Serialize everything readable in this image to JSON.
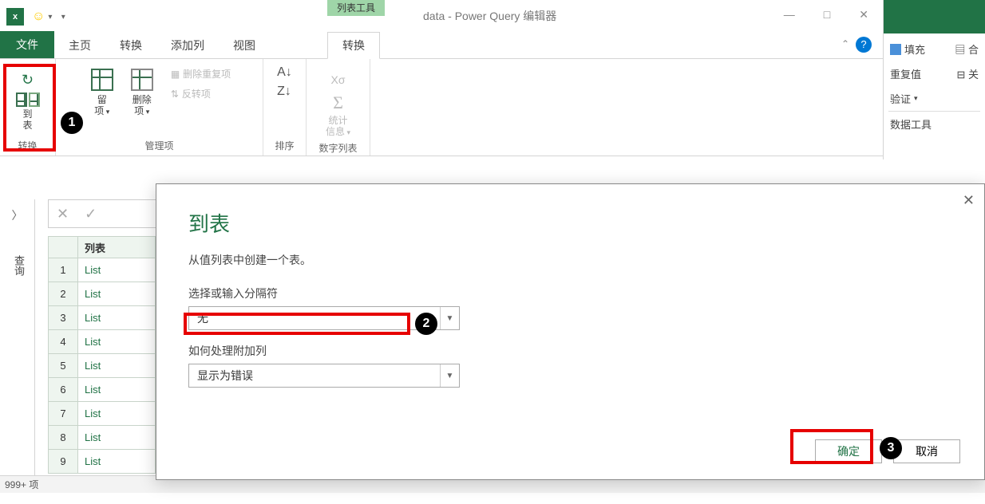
{
  "titlebar": {
    "app_icon_text": "x",
    "contextual_tab": "列表工具",
    "window_title": "data - Power Query 编辑器"
  },
  "window_controls": {
    "minimize": "—",
    "maximize": "□",
    "close": "✕"
  },
  "tabs": {
    "file": "文件",
    "home": "主页",
    "transform": "转换",
    "add_column": "添加列",
    "view": "视图",
    "transform2": "转换"
  },
  "ribbon": {
    "to_table": {
      "label_line1": "到",
      "label_line2": "表"
    },
    "keep_items": {
      "label_line1": "留",
      "label_line2": "项"
    },
    "remove_items": {
      "label_line1": "删除",
      "label_line2": "项"
    },
    "remove_duplicates": "删除重复项",
    "reverse": "反转项",
    "statistics": {
      "label_line1": "统计",
      "label_line2": "信息"
    },
    "group_transform": "转换",
    "group_manage": "管理项",
    "group_sort": "排序",
    "group_numeric": "数字列表"
  },
  "ribbon_collapse": "⌃",
  "side": {
    "arrow": "〉",
    "label": "查询"
  },
  "formula_bar": {
    "cancel": "✕",
    "confirm": "✓"
  },
  "grid": {
    "col_header": "列表",
    "rows": [
      {
        "n": "1",
        "v": "List"
      },
      {
        "n": "2",
        "v": "List"
      },
      {
        "n": "3",
        "v": "List"
      },
      {
        "n": "4",
        "v": "List"
      },
      {
        "n": "5",
        "v": "List"
      },
      {
        "n": "6",
        "v": "List"
      },
      {
        "n": "7",
        "v": "List"
      },
      {
        "n": "8",
        "v": "List"
      },
      {
        "n": "9",
        "v": "List"
      }
    ]
  },
  "dialog": {
    "title": "到表",
    "description": "从值列表中创建一个表。",
    "delimiter_label": "选择或输入分隔符",
    "delimiter_value": "无",
    "extra_cols_label": "如何处理附加列",
    "extra_cols_value": "显示为错误",
    "ok": "确定",
    "cancel": "取消",
    "close": "✕"
  },
  "statusbar": {
    "count": "999+ 项"
  },
  "excel_peek": {
    "fill": "填充",
    "merge": "合",
    "dup": "重复值",
    "close": "关",
    "validate": "验证",
    "tools": "数据工具"
  },
  "annotations": {
    "b1": "1",
    "b2": "2",
    "b3": "3"
  }
}
